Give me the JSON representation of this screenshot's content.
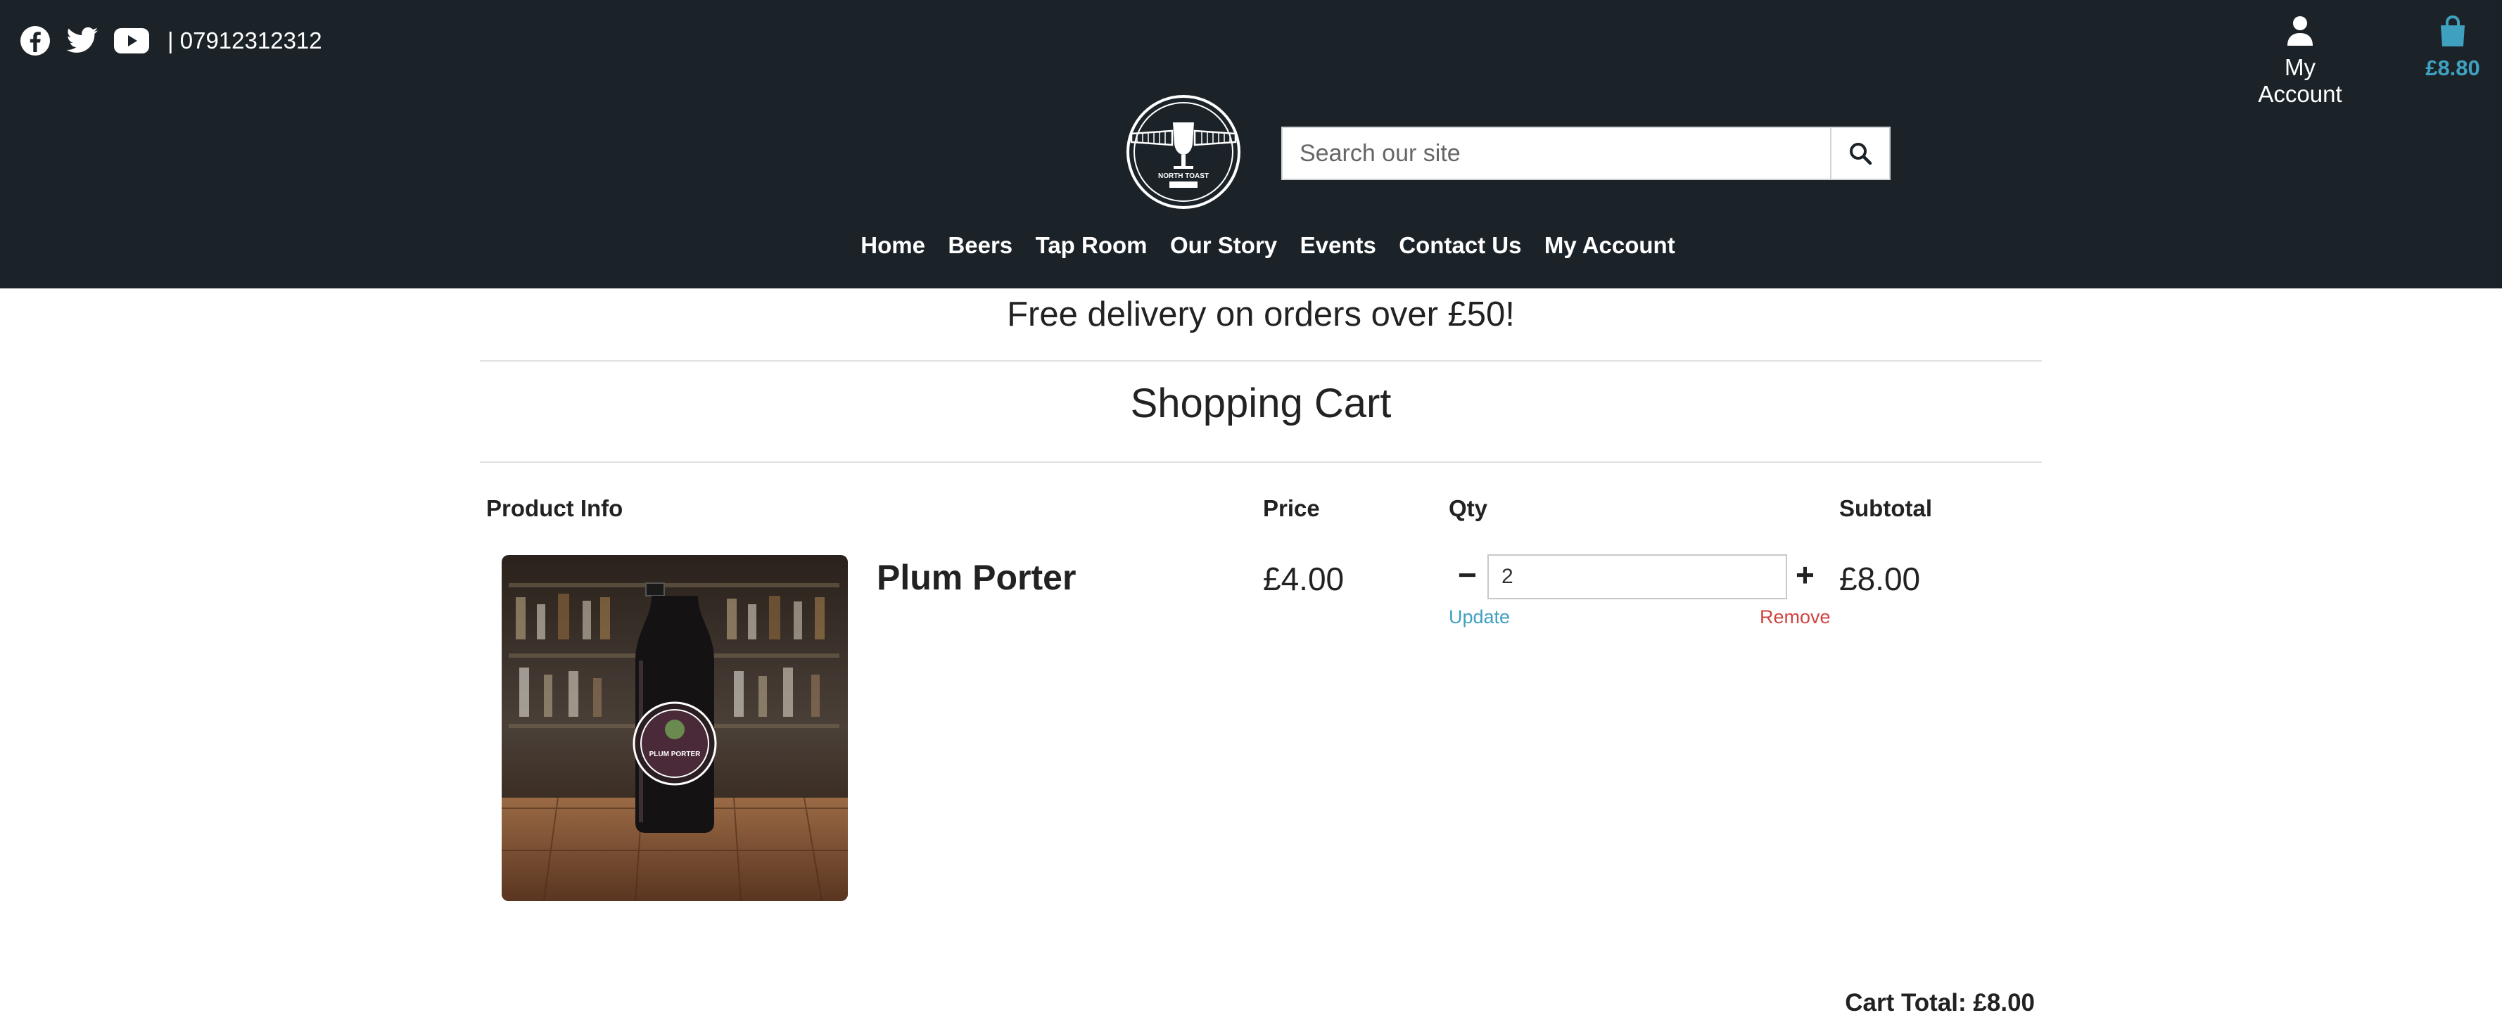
{
  "header": {
    "phone": "| 07912312312",
    "account_label": "My Account",
    "cart_amount": "£8.80",
    "search_placeholder": "Search our site",
    "logo_text": "NORTH TOAST",
    "social_icons": [
      "facebook-icon",
      "twitter-icon",
      "youtube-icon"
    ]
  },
  "nav": {
    "items": [
      "Home",
      "Beers",
      "Tap Room",
      "Our Story",
      "Events",
      "Contact Us",
      "My Account"
    ]
  },
  "promo": {
    "text": "Free delivery on orders over £50!"
  },
  "cart": {
    "title": "Shopping Cart",
    "columns": {
      "product": "Product Info",
      "price": "Price",
      "qty": "Qty",
      "subtotal": "Subtotal"
    },
    "items": [
      {
        "name": "Plum Porter",
        "image_label": "PLUM PORTER",
        "price": "£4.00",
        "qty": "2",
        "subtotal": "£8.00",
        "update_label": "Update",
        "remove_label": "Remove",
        "minus_label": "−",
        "plus_label": "+"
      }
    ],
    "total": "Cart Total: £8.00"
  },
  "colors": {
    "header_bg": "#1b2329",
    "accent": "#3fa0c0",
    "remove": "#d0443f"
  }
}
